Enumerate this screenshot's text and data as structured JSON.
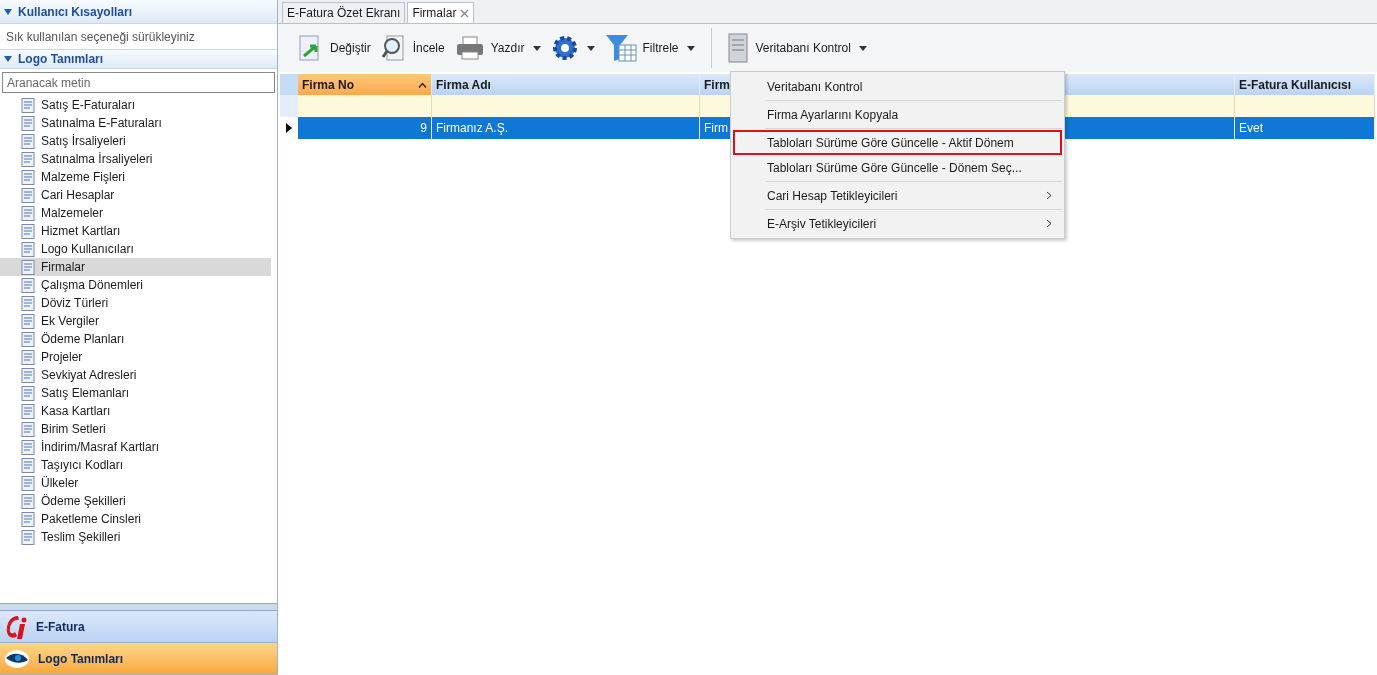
{
  "sidebar": {
    "shortcuts": {
      "title": "Kullanıcı Kısayolları",
      "expanded": true,
      "hint": "Sık kullanılan seçeneği sürükleyiniz"
    },
    "definitions": {
      "title": "Logo Tanımları",
      "expanded": true,
      "search": {
        "placeholder": "Aranacak metin"
      },
      "items": [
        {
          "label": "Satış E-Faturaları",
          "selected": false
        },
        {
          "label": "Satınalma E-Faturaları",
          "selected": false
        },
        {
          "label": "Satış İrsaliyeleri",
          "selected": false
        },
        {
          "label": "Satınalma İrsaliyeleri",
          "selected": false
        },
        {
          "label": "Malzeme Fişleri",
          "selected": false
        },
        {
          "label": "Cari Hesaplar",
          "selected": false
        },
        {
          "label": "Malzemeler",
          "selected": false
        },
        {
          "label": "Hizmet Kartları",
          "selected": false
        },
        {
          "label": "Logo Kullanıcıları",
          "selected": false
        },
        {
          "label": "Firmalar",
          "selected": true
        },
        {
          "label": "Çalışma Dönemleri",
          "selected": false
        },
        {
          "label": "Döviz Türleri",
          "selected": false
        },
        {
          "label": "Ek Vergiler",
          "selected": false
        },
        {
          "label": "Ödeme Planları",
          "selected": false
        },
        {
          "label": "Projeler",
          "selected": false
        },
        {
          "label": "Sevkiyat Adresleri",
          "selected": false
        },
        {
          "label": "Satış Elemanları",
          "selected": false
        },
        {
          "label": "Kasa Kartları",
          "selected": false
        },
        {
          "label": "Birim Setleri",
          "selected": false
        },
        {
          "label": "İndirim/Masraf Kartları",
          "selected": false
        },
        {
          "label": "Taşıyıcı Kodları",
          "selected": false
        },
        {
          "label": "Ülkeler",
          "selected": false
        },
        {
          "label": "Ödeme Şekilleri",
          "selected": false
        },
        {
          "label": "Paketleme Cinsleri",
          "selected": false
        },
        {
          "label": "Teslim Şekilleri",
          "selected": false
        }
      ]
    },
    "modules": [
      {
        "label": "E-Fatura",
        "selected": false
      },
      {
        "label": "Logo Tanımları",
        "selected": true
      }
    ]
  },
  "tabs": [
    {
      "label": "E-Fatura Özet Ekranı",
      "selected": false
    },
    {
      "label": "Firmalar",
      "selected": true
    }
  ],
  "toolbar": [
    {
      "label": "Değiştir",
      "dropdown": false
    },
    {
      "label": "İncele",
      "dropdown": false
    },
    {
      "label": "Yazdır",
      "dropdown": true
    },
    {
      "dropdown": true
    },
    {
      "label": "Filtrele",
      "dropdown": true
    },
    {
      "label": "Veritabanı Kontrol",
      "dropdown": true
    }
  ],
  "table": {
    "columns": [
      {
        "label": "Firma No",
        "sorted": true
      },
      {
        "label": "Firma Adı",
        "sorted": false
      },
      {
        "label": "Firm",
        "sorted": false
      },
      {
        "label": "E-Fatura Kullanıcısı",
        "sorted": false
      }
    ],
    "rows": [
      {
        "selected": true,
        "cells": [
          "9",
          "Firmanız A.Ş.",
          "Firm",
          "Evet"
        ]
      }
    ]
  },
  "context_menu": [
    {
      "label": "Veritabanı Kontrol",
      "highlighted": false,
      "submenu": false,
      "separator_after": true
    },
    {
      "label": "Firma Ayarlarını Kopyala",
      "highlighted": false,
      "submenu": false,
      "separator_after": true
    },
    {
      "label": "Tabloları Sürüme Göre Güncelle - Aktif Dönem",
      "highlighted": true,
      "submenu": false,
      "separator_after": false
    },
    {
      "label": "Tabloları Sürüme Göre Güncelle - Dönem Seç...",
      "highlighted": false,
      "submenu": false,
      "separator_after": true
    },
    {
      "label": "Cari Hesap Tetikleyicileri",
      "highlighted": false,
      "submenu": true,
      "separator_after": true
    },
    {
      "label": "E-Arşiv Tetikleyicileri",
      "highlighted": false,
      "submenu": true,
      "separator_after": false
    }
  ]
}
